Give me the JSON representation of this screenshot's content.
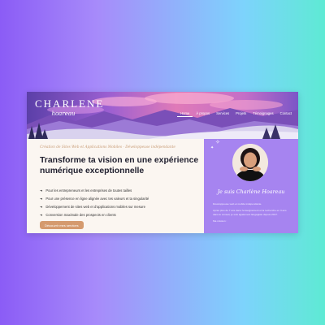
{
  "brand": {
    "name": "CHARLENE",
    "sub": "hoareau"
  },
  "nav": [
    {
      "label": "Home",
      "active": true
    },
    {
      "label": "À propos",
      "active": false
    },
    {
      "label": "Services",
      "active": false
    },
    {
      "label": "Projets",
      "active": false
    },
    {
      "label": "Témoignages",
      "active": false
    },
    {
      "label": "Contact",
      "active": false
    }
  ],
  "hero": {
    "subtitle": "Création de Sites Web et Applications Mobiles - Développeuse indépendante",
    "headline": "Transforme ta vision en une expérience numérique exceptionnelle",
    "bullets": [
      "Pour les entrepreneurs et les entreprises de toutes tailles",
      "Pour une présence en ligne alignée avec tes valeurs et ta singularité",
      "Développement de sites web et d'applications mobiles sur mesure",
      "Conversion maximale des prospects en clients"
    ],
    "cta": "Découvrir mes services"
  },
  "profile": {
    "title": "Je suis Charlène Hoareau",
    "paragraphs": [
      "Développeuse web et mobile indépendante.",
      "Après plus de 7 ans dans l'enseignement et la recherche en 3 ans dans le conseil, je suis également langagiste depuis 2017.",
      "Ma mission :"
    ]
  },
  "colors": {
    "accent": "#d59a6e",
    "panel": "#a684f0",
    "headline": "#1f1f2e"
  }
}
